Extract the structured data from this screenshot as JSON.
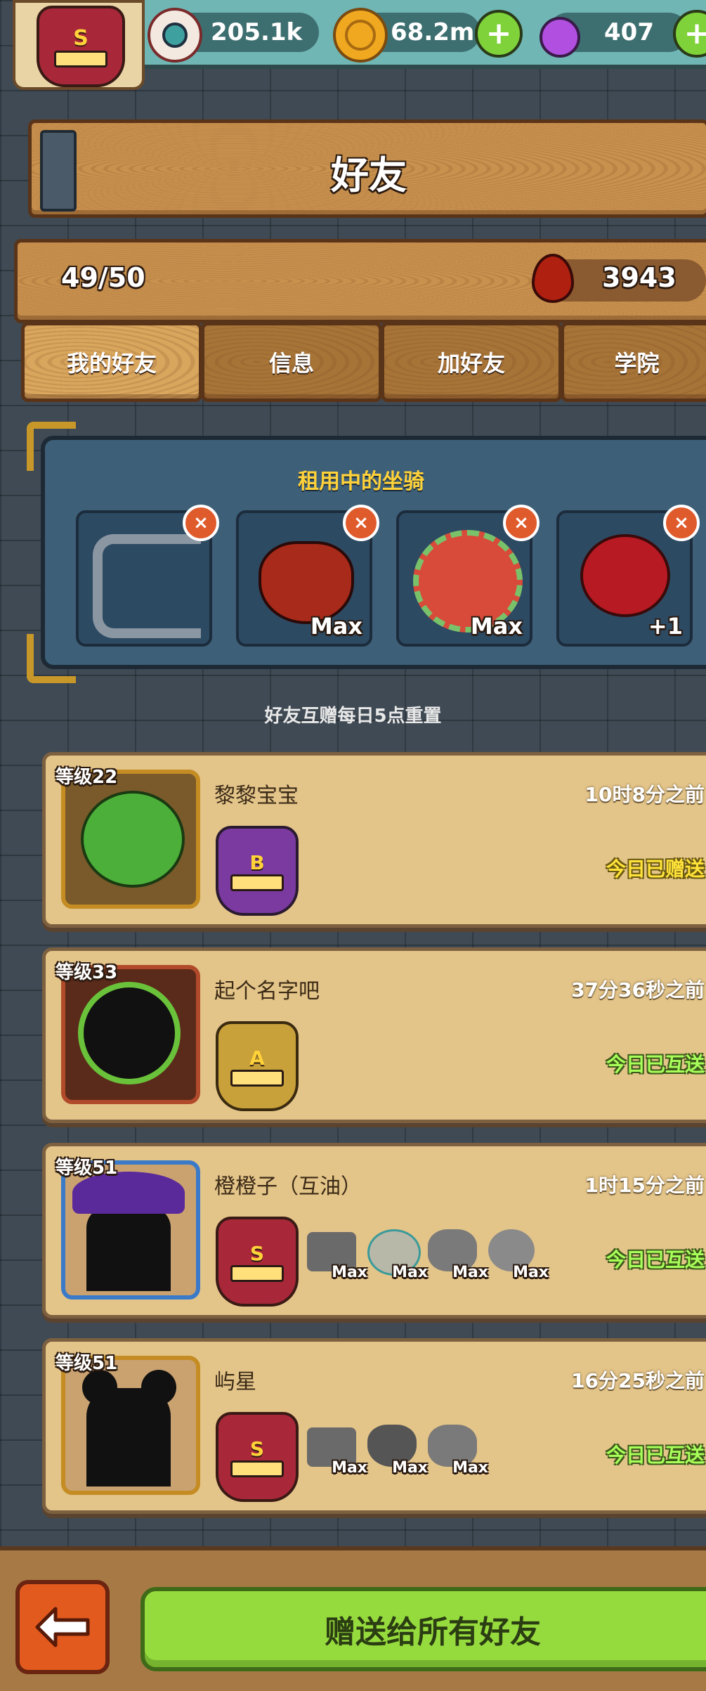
{
  "header": {
    "rank_badge_letter": "S",
    "eyeball_count": "205.1k",
    "coin_count": "68.2m",
    "potion_count": "407"
  },
  "title": "好友",
  "stats": {
    "friend_count": "49/50",
    "blood_count": "3943"
  },
  "tabs": [
    {
      "label": "我的好友",
      "active": true
    },
    {
      "label": "信息",
      "active": false
    },
    {
      "label": "加好友",
      "active": false
    },
    {
      "label": "学院",
      "active": false
    }
  ],
  "mounts_panel": {
    "title": "租用中的坐骑",
    "mounts": [
      {
        "icon": "mech-mount-icon",
        "label": ""
      },
      {
        "icon": "horned-demon-mount-icon",
        "label": "Max"
      },
      {
        "icon": "lion-dance-mount-icon",
        "label": "Max"
      },
      {
        "icon": "rose-mount-icon",
        "label": "+1"
      }
    ]
  },
  "reset_notice": "好友互赠每日5点重置",
  "friends": [
    {
      "level": "等级22",
      "name": "黎黎宝宝",
      "time": "10时8分之前",
      "status": "今日已赠送",
      "badge": "B",
      "badge_color": "#7a3aa0",
      "avatar": "cabbage-avatar-icon",
      "mounts": []
    },
    {
      "level": "等级33",
      "name": "起个名字吧",
      "time": "37分36秒之前",
      "status": "今日已互送",
      "badge": "A",
      "badge_color": "#c9a13a",
      "avatar": "fuzzy-black-avatar-icon",
      "mounts": []
    },
    {
      "level": "等级51",
      "name": "橙橙子（互油）",
      "time": "1时15分之前",
      "status": "今日已互送",
      "badge": "S",
      "badge_color": "#a8283a",
      "avatar": "witch-hat-avatar-icon",
      "mounts": [
        {
          "icon": "mech-mount-icon",
          "label": "Max"
        },
        {
          "icon": "lion-dance-mount-icon",
          "label": "Max"
        },
        {
          "icon": "dragon-mount-icon",
          "label": "Max"
        },
        {
          "icon": "rose-mount-icon",
          "label": "Max"
        }
      ]
    },
    {
      "level": "等级51",
      "name": "屿星",
      "time": "16分25秒之前",
      "status": "今日已互送",
      "badge": "S",
      "badge_color": "#a8283a",
      "avatar": "bun-hair-avatar-icon",
      "mounts": [
        {
          "icon": "mech-mount-icon",
          "label": "Max"
        },
        {
          "icon": "horned-demon-mount-icon",
          "label": "Max"
        },
        {
          "icon": "dragon-mount-icon",
          "label": "Max"
        }
      ]
    }
  ],
  "footer": {
    "give_all_label": "赠送给所有好友"
  }
}
